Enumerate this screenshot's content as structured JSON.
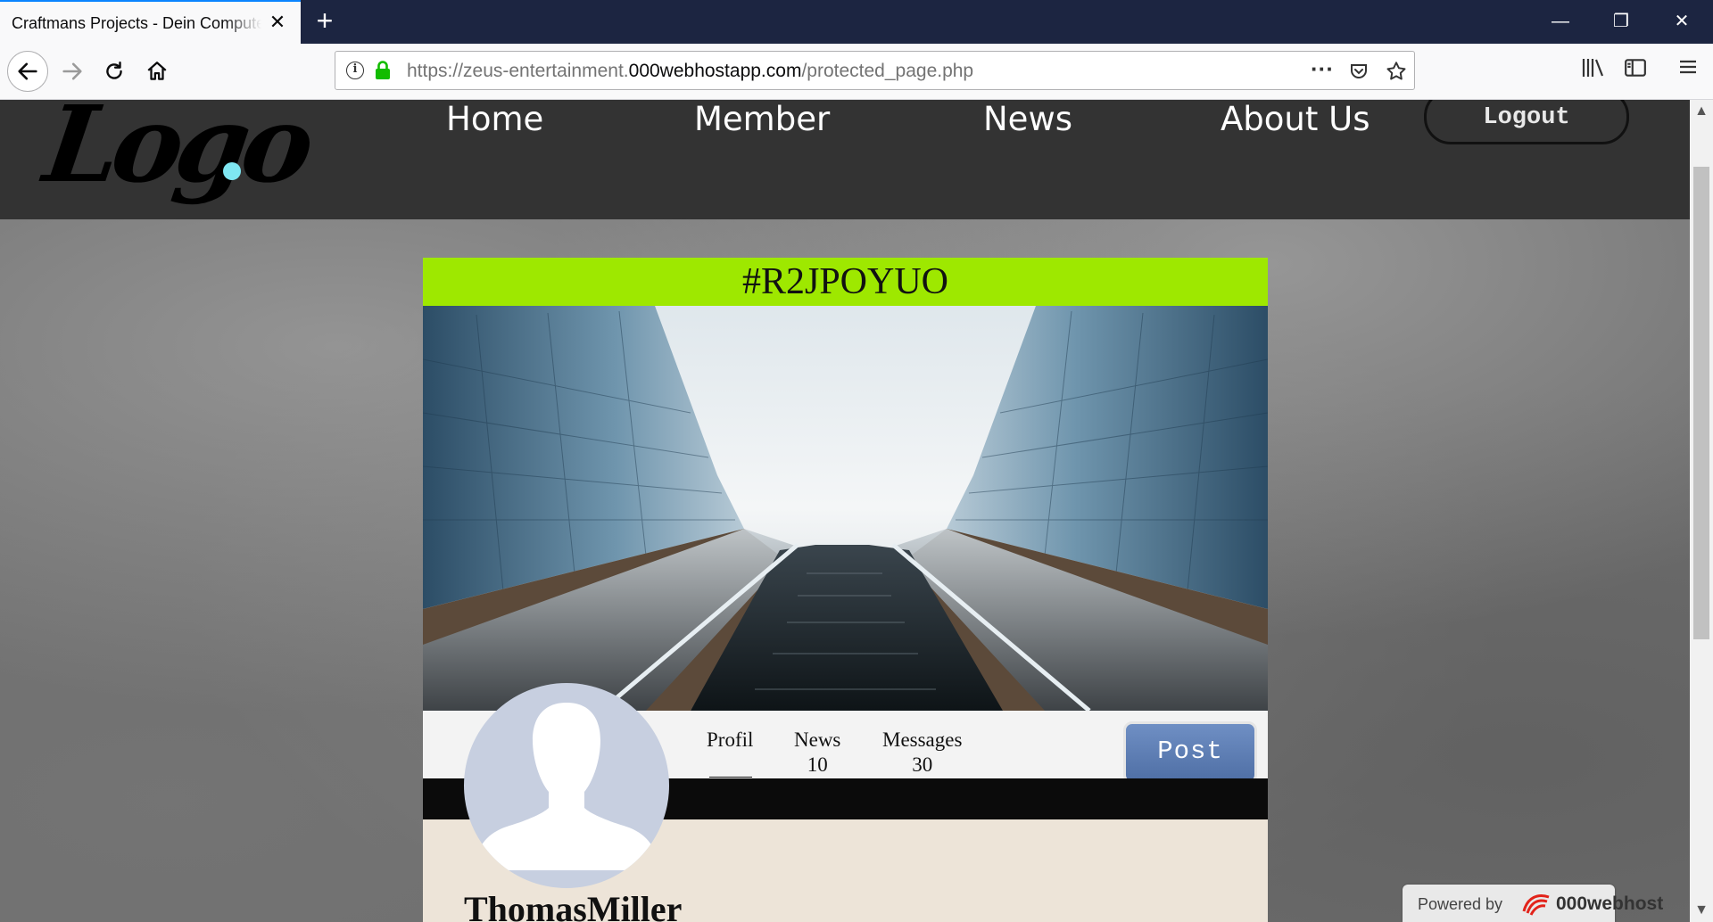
{
  "browser": {
    "tab_title": "Craftmans Projects - Dein Computer",
    "tab_close": "✕",
    "new_tab": "+",
    "window_controls": {
      "minimize": "—",
      "restore": "❐",
      "close": "✕"
    },
    "url": {
      "prefix": "https://zeus-entertainment.",
      "host": "000webhostapp.com",
      "path": "/protected_page.php"
    },
    "icons": [
      "back-icon",
      "forward-icon",
      "reload-icon",
      "home-icon",
      "info-icon",
      "lock-icon",
      "page-actions-icon",
      "pocket-icon",
      "bookmark-star-icon",
      "library-icon",
      "sidebar-icon",
      "menu-icon"
    ]
  },
  "site": {
    "logo_text": "Logo",
    "nav": {
      "home": "Home",
      "member": "Member",
      "news": "News",
      "about": "About Us",
      "logout": "Logout"
    }
  },
  "profile": {
    "code": "#R2JPOYUO",
    "username": "ThomasMiller",
    "stats": {
      "profil_label": "Profil",
      "news_label": "News",
      "news_count": "10",
      "messages_label": "Messages",
      "messages_count": "30"
    },
    "post_label": "Post"
  },
  "badge": {
    "powered_by": "Powered by",
    "brand": "000webhost"
  },
  "colors": {
    "accent_green": "#9ee800",
    "header_dark": "#333333",
    "post_blue": "#5a7ab0",
    "logo_dot": "#7fe7f2"
  }
}
